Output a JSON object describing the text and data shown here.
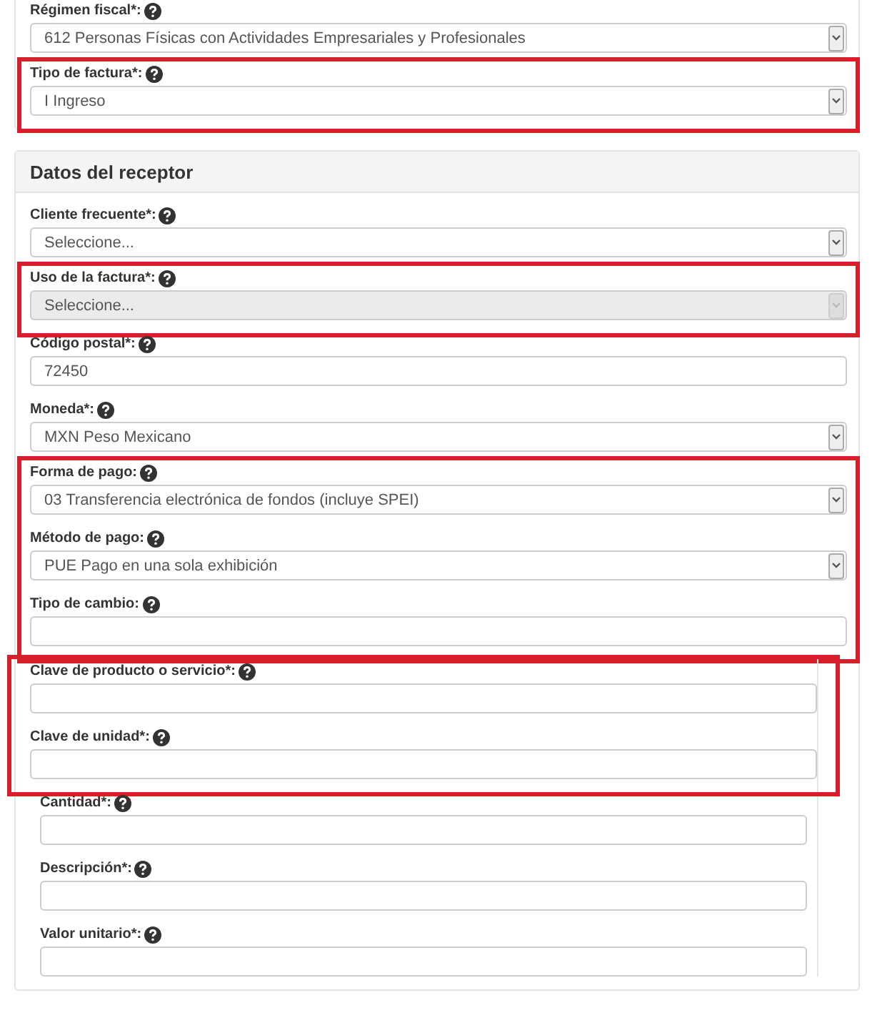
{
  "fiscal_panel": {
    "groups": [
      {
        "highlighted": false,
        "fields": [
          {
            "label": "Régimen fiscal*:",
            "kind": "select",
            "value": "612 Personas Físicas con Actividades Empresariales y Profesionales",
            "disabled": false
          }
        ]
      },
      {
        "highlighted": true,
        "fields": [
          {
            "label": "Tipo de factura*:",
            "kind": "select",
            "value": "I Ingreso",
            "disabled": false
          }
        ]
      }
    ]
  },
  "receptor_panel": {
    "title": "Datos del receptor",
    "groups": [
      {
        "highlighted": false,
        "fields": [
          {
            "label": "Cliente frecuente*:",
            "kind": "select",
            "value": "Seleccione...",
            "disabled": false
          }
        ]
      },
      {
        "highlighted": true,
        "fields": [
          {
            "label": "Uso de la factura*:",
            "kind": "select",
            "value": "Seleccione...",
            "disabled": true
          }
        ]
      },
      {
        "highlighted": false,
        "fields": [
          {
            "label": "Código postal*:",
            "kind": "input",
            "value": "72450"
          },
          {
            "label": "Moneda*:",
            "kind": "select",
            "value": "MXN Peso Mexicano",
            "disabled": false
          }
        ]
      },
      {
        "highlighted": true,
        "fields": [
          {
            "label": "Forma de pago:",
            "kind": "select",
            "value": "03 Transferencia electrónica de fondos (incluye SPEI)",
            "disabled": false
          },
          {
            "label": "Método de pago:",
            "kind": "select",
            "value": "PUE Pago en una sola exhibición",
            "disabled": false
          },
          {
            "label": "Tipo de cambio:",
            "kind": "input"
          }
        ]
      }
    ],
    "concepts": {
      "groups": [
        {
          "highlighted": true,
          "fields": [
            {
              "label": "Clave de producto o servicio*:",
              "kind": "input"
            },
            {
              "label": "Clave de unidad*:",
              "kind": "input"
            }
          ]
        },
        {
          "highlighted": false,
          "fields": [
            {
              "label": "Cantidad*:",
              "kind": "input"
            },
            {
              "label": "Descripción*:",
              "kind": "input"
            },
            {
              "label": "Valor unitario*:",
              "kind": "input"
            }
          ]
        }
      ]
    }
  }
}
